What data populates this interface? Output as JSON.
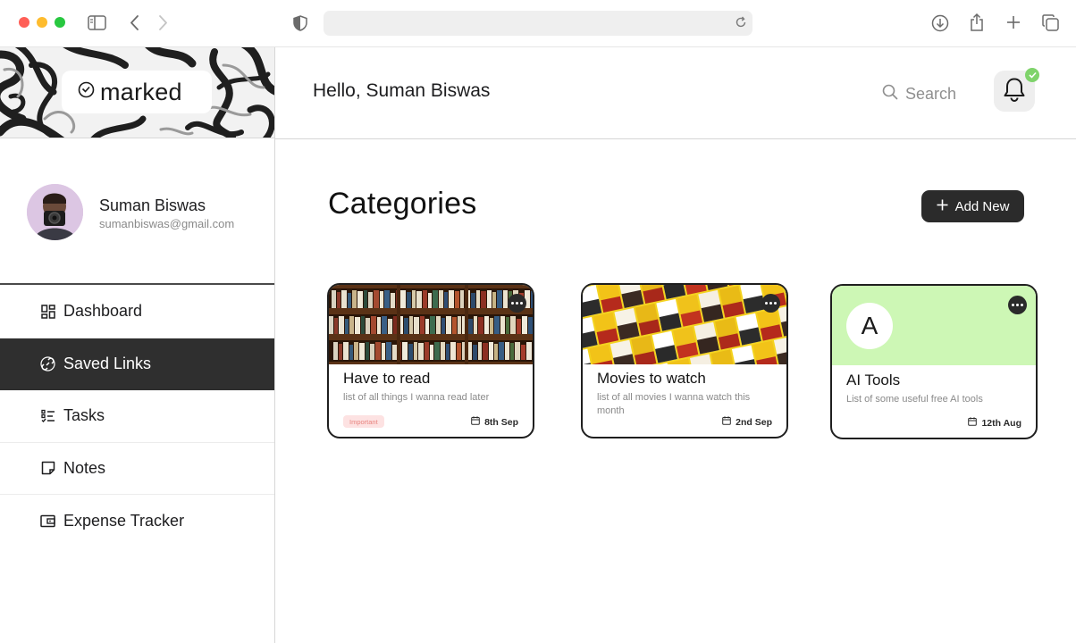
{
  "brand": {
    "name": "marked"
  },
  "header": {
    "greeting": "Hello, Suman Biswas",
    "search_label": "Search"
  },
  "profile": {
    "name": "Suman Biswas",
    "email": "sumanbiswas@gmail.com"
  },
  "sidebar": {
    "items": [
      {
        "label": "Dashboard",
        "icon": "dashboard-icon",
        "active": false
      },
      {
        "label": "Saved Links",
        "icon": "link-icon",
        "active": true
      },
      {
        "label": "Tasks",
        "icon": "tasks-icon",
        "active": false
      },
      {
        "label": "Notes",
        "icon": "note-icon",
        "active": false
      },
      {
        "label": "Expense Tracker",
        "icon": "wallet-icon",
        "active": false
      }
    ]
  },
  "main": {
    "title": "Categories",
    "add_label": "Add New",
    "categories": [
      {
        "title": "Have to read",
        "description": "list of all things I wanna read later",
        "tag": "Important",
        "date": "8th Sep",
        "cover": "bookshelf-image"
      },
      {
        "title": "Movies to watch",
        "description": "list of all movies I wanna watch this month",
        "date": "2nd Sep",
        "cover": "movie-posters-image"
      },
      {
        "title": "AI Tools",
        "description": "List of some useful free AI tools",
        "date": "12th Aug",
        "cover_letter": "A",
        "cover_color": "#cdf7b5"
      }
    ]
  },
  "colors": {
    "active_nav_bg": "#2f2f2f",
    "add_button_bg": "#2b2b2b",
    "notification_badge": "#7fd36b",
    "tag_bg": "#fde2e2",
    "tag_text": "#e8847f",
    "ai_cover": "#cdf7b5"
  }
}
